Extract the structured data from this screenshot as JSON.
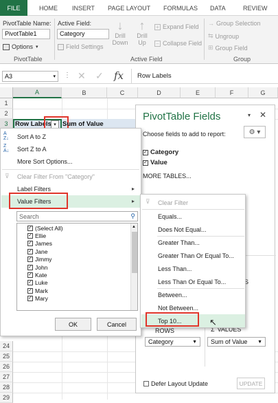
{
  "ribbon": {
    "tabs": [
      "FILE",
      "HOME",
      "INSERT",
      "PAGE LAYOUT",
      "FORMULAS",
      "DATA",
      "REVIEW"
    ],
    "pivottable_name_label": "PivotTable Name:",
    "pivottable_name_value": "PivotTable1",
    "options_label": "Options",
    "pivottable_group": "PivotTable",
    "active_field_label": "Active Field:",
    "active_field_value": "Category",
    "field_settings": "Field Settings",
    "drill_down_1": "Drill",
    "drill_down_2": "Down",
    "drill_up_1": "Drill",
    "drill_up_2": "Up",
    "expand_field": "Expand Field",
    "collapse_field": "Collapse Field",
    "active_field_group": "Active Field",
    "group_selection": "Group Selection",
    "ungroup": "Ungroup",
    "group_field": "Group Field",
    "group_group": "Group"
  },
  "formula_bar": {
    "name_box": "A3",
    "fx": "fx",
    "content": "Row Labels"
  },
  "grid": {
    "columns": [
      "A",
      "B",
      "C",
      "D",
      "E",
      "F",
      "G"
    ],
    "rows_top": [
      "1",
      "2",
      "3"
    ],
    "rows_bottom": [
      "24",
      "25",
      "26",
      "27",
      "28",
      "29",
      "30"
    ],
    "a3": "Row Labels",
    "b3": "Sum of Value"
  },
  "filter_menu": {
    "sort_az": "Sort A to Z",
    "sort_za": "Sort Z to A",
    "more_sort": "More Sort Options...",
    "clear_filter": "Clear Filter From \"Category\"",
    "label_filters": "Label Filters",
    "value_filters": "Value Filters",
    "search_placeholder": "Search",
    "items": [
      "(Select All)",
      "Ellie",
      "James",
      "Jane",
      "Jimmy",
      "John",
      "Kate",
      "Luke",
      "Mark",
      "Mary"
    ],
    "ok": "OK",
    "cancel": "Cancel"
  },
  "value_filters_menu": {
    "items": [
      "Clear Filter",
      "Equals...",
      "Does Not Equal...",
      "Greater Than...",
      "Greater Than Or Equal To...",
      "Less Than...",
      "Less Than Or Equal To...",
      "Between...",
      "Not Between...",
      "Top 10..."
    ]
  },
  "pivot_pane": {
    "title": "PivotTable Fields",
    "choose": "Choose fields to add to report:",
    "fields": [
      "Category",
      "Value"
    ],
    "more_tables": "MORE TABLES...",
    "values_area_frag": "S",
    "rows_label": "ROWS",
    "values_label": "VALUES",
    "rows_field": "Category",
    "values_field": "Sum of Value",
    "defer_update": "Defer Layout Update",
    "update": "UPDATE"
  },
  "colors": {
    "excel_green": "#217346",
    "highlight": "#dbf0e2",
    "annotation_red": "#e0352b"
  }
}
